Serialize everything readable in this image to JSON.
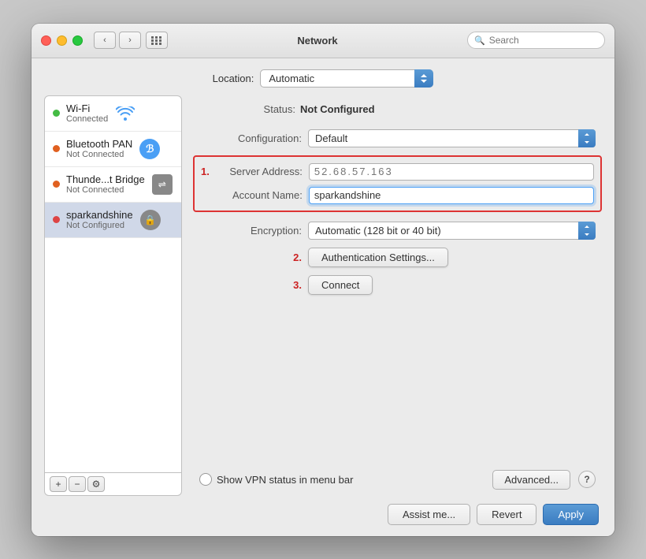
{
  "window": {
    "title": "Network"
  },
  "titlebar": {
    "back_label": "‹",
    "forward_label": "›",
    "search_placeholder": "Search"
  },
  "location": {
    "label": "Location:",
    "value": "Automatic"
  },
  "sidebar": {
    "items": [
      {
        "id": "wifi",
        "name": "Wi-Fi",
        "status": "Connected",
        "status_color": "green",
        "icon_type": "wifi"
      },
      {
        "id": "bluetooth",
        "name": "Bluetooth PAN",
        "status": "Not Connected",
        "status_color": "orange",
        "icon_type": "bluetooth"
      },
      {
        "id": "thunderbolt",
        "name": "Thunde...t Bridge",
        "status": "Not Connected",
        "status_color": "orange",
        "icon_type": "thunderbolt"
      },
      {
        "id": "sparkandshine",
        "name": "sparkandshine",
        "status": "Not Configured",
        "status_color": "red",
        "icon_type": "lock"
      }
    ],
    "add_label": "+",
    "remove_label": "−",
    "gear_label": "⚙"
  },
  "detail": {
    "status_label": "Status:",
    "status_value": "Not Configured",
    "config_label": "Configuration:",
    "config_value": "Default",
    "server_address_label": "Server Address:",
    "server_address_value": "52.68.57.163",
    "account_name_label": "Account Name:",
    "account_name_value": "sparkandshine",
    "encryption_label": "Encryption:",
    "encryption_value": "Automatic (128 bit or 40 bit)",
    "step1_label": "1.",
    "step2_label": "2.",
    "step3_label": "3.",
    "auth_settings_label": "Authentication Settings...",
    "connect_label": "Connect",
    "vpn_status_label": "Show VPN status in menu bar",
    "advanced_label": "Advanced...",
    "help_label": "?"
  },
  "footer": {
    "assist_label": "Assist me...",
    "revert_label": "Revert",
    "apply_label": "Apply"
  }
}
